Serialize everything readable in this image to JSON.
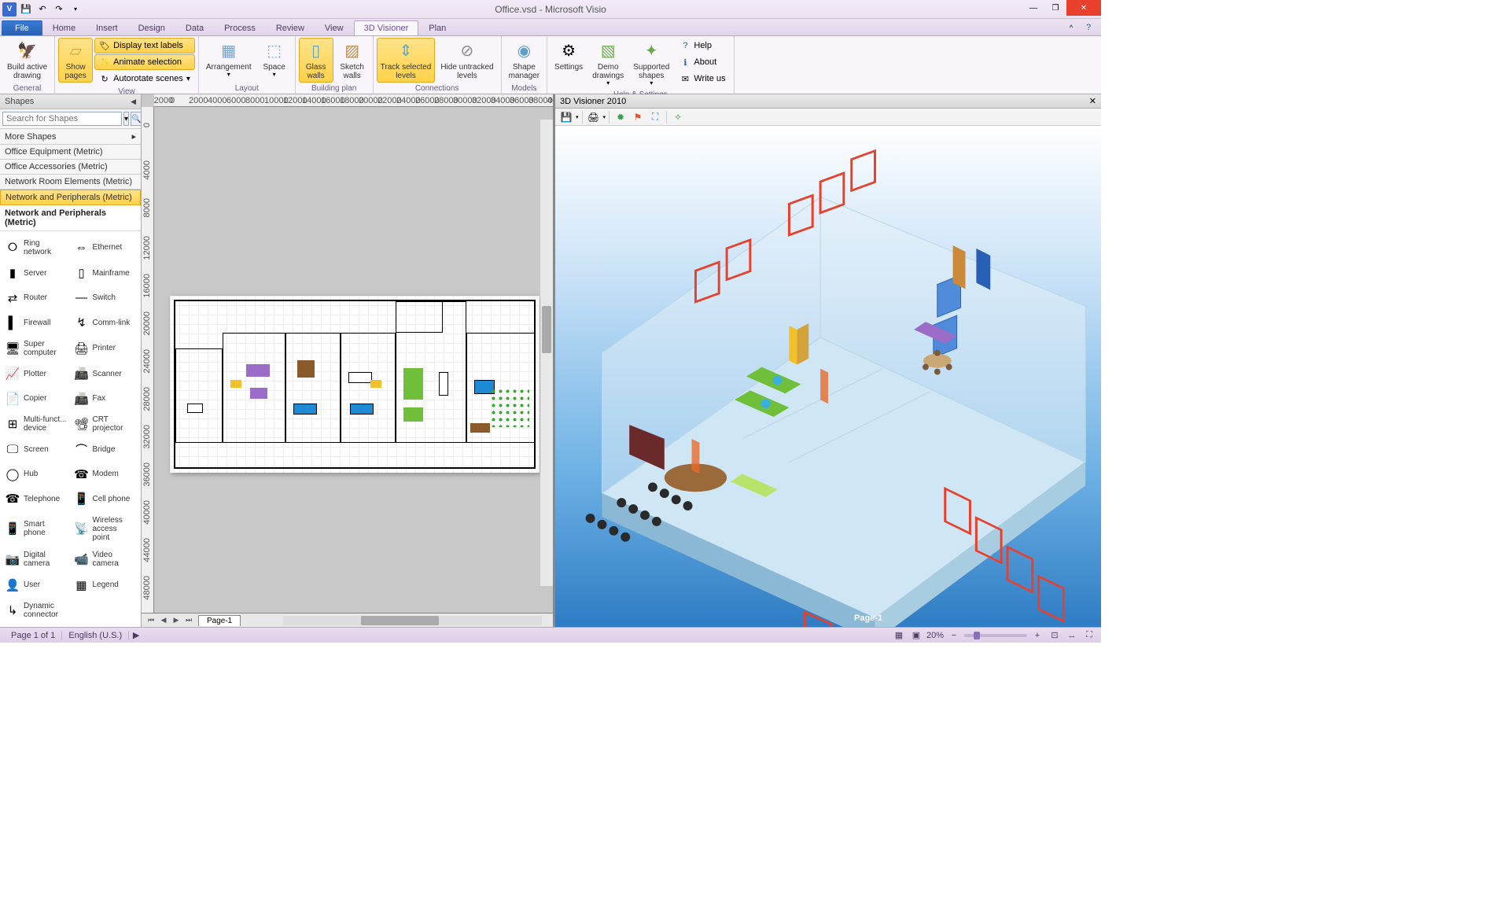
{
  "titlebar": {
    "title": "Office.vsd - Microsoft Visio",
    "app_icon": "V"
  },
  "tabs": {
    "file": "File",
    "items": [
      "Home",
      "Insert",
      "Design",
      "Data",
      "Process",
      "Review",
      "View",
      "3D Visioner",
      "Plan"
    ],
    "active": "3D Visioner"
  },
  "ribbon": {
    "general": {
      "label": "General",
      "build": "Build active\ndrawing"
    },
    "view": {
      "label": "View",
      "show_pages": "Show\npages",
      "display_labels": "Display text labels",
      "animate": "Animate selection",
      "autorotate": "Autorotate scenes"
    },
    "layout": {
      "label": "Layout",
      "arrangement": "Arrangement",
      "space": "Space"
    },
    "building": {
      "label": "Building plan",
      "glass": "Glass\nwalls",
      "sketch": "Sketch\nwalls"
    },
    "connections": {
      "label": "Connections",
      "track": "Track selected\nlevels",
      "hide": "Hide untracked\nlevels"
    },
    "models": {
      "label": "Models",
      "shape": "Shape\nmanager"
    },
    "help": {
      "label": "Help & Settings",
      "settings": "Settings",
      "demo": "Demo\ndrawings",
      "supported": "Supported\nshapes",
      "help_link": "Help",
      "about": "About",
      "write": "Write us"
    }
  },
  "shapes_panel": {
    "header": "Shapes",
    "search_placeholder": "Search for Shapes",
    "more": "More Shapes",
    "categories": [
      "Office Equipment (Metric)",
      "Office Accessories (Metric)",
      "Network Room Elements (Metric)",
      "Network and Peripherals (Metric)"
    ],
    "selected_category": "Network and Peripherals (Metric)",
    "stencil_title": "Network and Peripherals (Metric)",
    "items": [
      {
        "icon": "⭘",
        "label": "Ring network"
      },
      {
        "icon": "⇔",
        "label": "Ethernet"
      },
      {
        "icon": "▮",
        "label": "Server"
      },
      {
        "icon": "▯",
        "label": "Mainframe"
      },
      {
        "icon": "⇄",
        "label": "Router"
      },
      {
        "icon": "—",
        "label": "Switch"
      },
      {
        "icon": "▌",
        "label": "Firewall"
      },
      {
        "icon": "↯",
        "label": "Comm-link"
      },
      {
        "icon": "🖥",
        "label": "Super computer"
      },
      {
        "icon": "🖨",
        "label": "Printer"
      },
      {
        "icon": "📈",
        "label": "Plotter"
      },
      {
        "icon": "📠",
        "label": "Scanner"
      },
      {
        "icon": "📄",
        "label": "Copier"
      },
      {
        "icon": "📠",
        "label": "Fax"
      },
      {
        "icon": "⊞",
        "label": "Multi-funct... device"
      },
      {
        "icon": "📽",
        "label": "CRT projector"
      },
      {
        "icon": "🖵",
        "label": "Screen"
      },
      {
        "icon": "⌒",
        "label": "Bridge"
      },
      {
        "icon": "◯",
        "label": "Hub"
      },
      {
        "icon": "☎",
        "label": "Modem"
      },
      {
        "icon": "☎",
        "label": "Telephone"
      },
      {
        "icon": "📱",
        "label": "Cell phone"
      },
      {
        "icon": "📱",
        "label": "Smart phone"
      },
      {
        "icon": "📡",
        "label": "Wireless access point"
      },
      {
        "icon": "📷",
        "label": "Digital camera"
      },
      {
        "icon": "📹",
        "label": "Video camera"
      },
      {
        "icon": "👤",
        "label": "User"
      },
      {
        "icon": "▦",
        "label": "Legend"
      },
      {
        "icon": "↳",
        "label": "Dynamic connector"
      }
    ]
  },
  "canvas": {
    "page_tab": "Page-1"
  },
  "pane3d": {
    "title": "3D Visioner 2010",
    "page_label": "Page-1"
  },
  "statusbar": {
    "page": "Page 1 of 1",
    "lang": "English (U.S.)",
    "zoom": "20%"
  }
}
